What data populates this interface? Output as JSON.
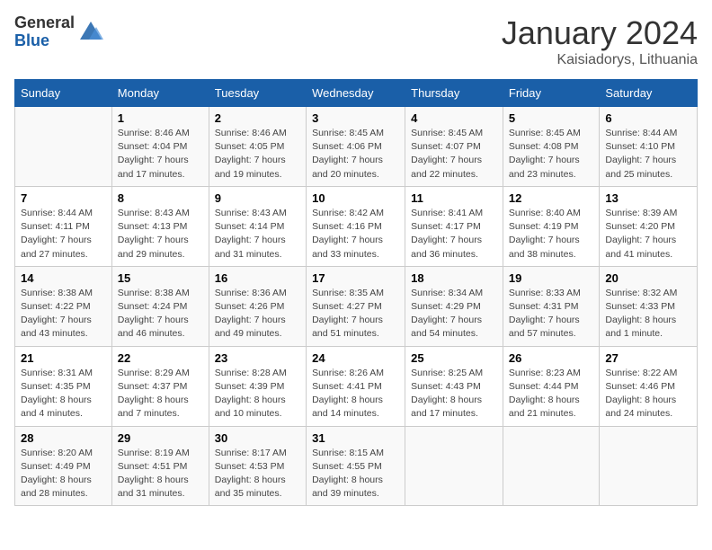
{
  "header": {
    "logo_general": "General",
    "logo_blue": "Blue",
    "title": "January 2024",
    "location": "Kaisiadorys, Lithuania"
  },
  "days_of_week": [
    "Sunday",
    "Monday",
    "Tuesday",
    "Wednesday",
    "Thursday",
    "Friday",
    "Saturday"
  ],
  "weeks": [
    [
      {
        "day": "",
        "info": ""
      },
      {
        "day": "1",
        "info": "Sunrise: 8:46 AM\nSunset: 4:04 PM\nDaylight: 7 hours\nand 17 minutes."
      },
      {
        "day": "2",
        "info": "Sunrise: 8:46 AM\nSunset: 4:05 PM\nDaylight: 7 hours\nand 19 minutes."
      },
      {
        "day": "3",
        "info": "Sunrise: 8:45 AM\nSunset: 4:06 PM\nDaylight: 7 hours\nand 20 minutes."
      },
      {
        "day": "4",
        "info": "Sunrise: 8:45 AM\nSunset: 4:07 PM\nDaylight: 7 hours\nand 22 minutes."
      },
      {
        "day": "5",
        "info": "Sunrise: 8:45 AM\nSunset: 4:08 PM\nDaylight: 7 hours\nand 23 minutes."
      },
      {
        "day": "6",
        "info": "Sunrise: 8:44 AM\nSunset: 4:10 PM\nDaylight: 7 hours\nand 25 minutes."
      }
    ],
    [
      {
        "day": "7",
        "info": "Sunrise: 8:44 AM\nSunset: 4:11 PM\nDaylight: 7 hours\nand 27 minutes."
      },
      {
        "day": "8",
        "info": "Sunrise: 8:43 AM\nSunset: 4:13 PM\nDaylight: 7 hours\nand 29 minutes."
      },
      {
        "day": "9",
        "info": "Sunrise: 8:43 AM\nSunset: 4:14 PM\nDaylight: 7 hours\nand 31 minutes."
      },
      {
        "day": "10",
        "info": "Sunrise: 8:42 AM\nSunset: 4:16 PM\nDaylight: 7 hours\nand 33 minutes."
      },
      {
        "day": "11",
        "info": "Sunrise: 8:41 AM\nSunset: 4:17 PM\nDaylight: 7 hours\nand 36 minutes."
      },
      {
        "day": "12",
        "info": "Sunrise: 8:40 AM\nSunset: 4:19 PM\nDaylight: 7 hours\nand 38 minutes."
      },
      {
        "day": "13",
        "info": "Sunrise: 8:39 AM\nSunset: 4:20 PM\nDaylight: 7 hours\nand 41 minutes."
      }
    ],
    [
      {
        "day": "14",
        "info": "Sunrise: 8:38 AM\nSunset: 4:22 PM\nDaylight: 7 hours\nand 43 minutes."
      },
      {
        "day": "15",
        "info": "Sunrise: 8:38 AM\nSunset: 4:24 PM\nDaylight: 7 hours\nand 46 minutes."
      },
      {
        "day": "16",
        "info": "Sunrise: 8:36 AM\nSunset: 4:26 PM\nDaylight: 7 hours\nand 49 minutes."
      },
      {
        "day": "17",
        "info": "Sunrise: 8:35 AM\nSunset: 4:27 PM\nDaylight: 7 hours\nand 51 minutes."
      },
      {
        "day": "18",
        "info": "Sunrise: 8:34 AM\nSunset: 4:29 PM\nDaylight: 7 hours\nand 54 minutes."
      },
      {
        "day": "19",
        "info": "Sunrise: 8:33 AM\nSunset: 4:31 PM\nDaylight: 7 hours\nand 57 minutes."
      },
      {
        "day": "20",
        "info": "Sunrise: 8:32 AM\nSunset: 4:33 PM\nDaylight: 8 hours\nand 1 minute."
      }
    ],
    [
      {
        "day": "21",
        "info": "Sunrise: 8:31 AM\nSunset: 4:35 PM\nDaylight: 8 hours\nand 4 minutes."
      },
      {
        "day": "22",
        "info": "Sunrise: 8:29 AM\nSunset: 4:37 PM\nDaylight: 8 hours\nand 7 minutes."
      },
      {
        "day": "23",
        "info": "Sunrise: 8:28 AM\nSunset: 4:39 PM\nDaylight: 8 hours\nand 10 minutes."
      },
      {
        "day": "24",
        "info": "Sunrise: 8:26 AM\nSunset: 4:41 PM\nDaylight: 8 hours\nand 14 minutes."
      },
      {
        "day": "25",
        "info": "Sunrise: 8:25 AM\nSunset: 4:43 PM\nDaylight: 8 hours\nand 17 minutes."
      },
      {
        "day": "26",
        "info": "Sunrise: 8:23 AM\nSunset: 4:44 PM\nDaylight: 8 hours\nand 21 minutes."
      },
      {
        "day": "27",
        "info": "Sunrise: 8:22 AM\nSunset: 4:46 PM\nDaylight: 8 hours\nand 24 minutes."
      }
    ],
    [
      {
        "day": "28",
        "info": "Sunrise: 8:20 AM\nSunset: 4:49 PM\nDaylight: 8 hours\nand 28 minutes."
      },
      {
        "day": "29",
        "info": "Sunrise: 8:19 AM\nSunset: 4:51 PM\nDaylight: 8 hours\nand 31 minutes."
      },
      {
        "day": "30",
        "info": "Sunrise: 8:17 AM\nSunset: 4:53 PM\nDaylight: 8 hours\nand 35 minutes."
      },
      {
        "day": "31",
        "info": "Sunrise: 8:15 AM\nSunset: 4:55 PM\nDaylight: 8 hours\nand 39 minutes."
      },
      {
        "day": "",
        "info": ""
      },
      {
        "day": "",
        "info": ""
      },
      {
        "day": "",
        "info": ""
      }
    ]
  ]
}
